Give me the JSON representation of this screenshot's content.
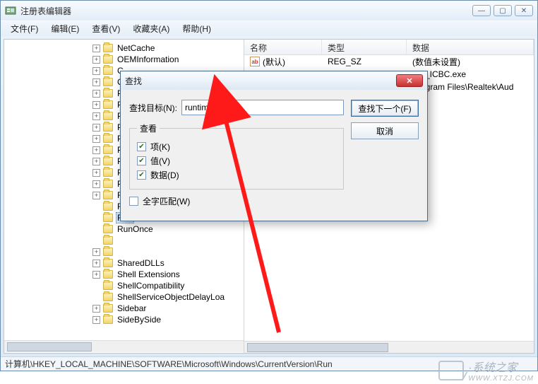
{
  "window": {
    "title": "注册表编辑器",
    "buttons": {
      "min": "—",
      "max": "▢",
      "close": "✕"
    }
  },
  "menu": {
    "file": "文件(F)",
    "edit": "编辑(E)",
    "view": "查看(V)",
    "favorites": "收藏夹(A)",
    "help": "帮助(H)"
  },
  "tree": {
    "items": [
      {
        "toggle": "+",
        "label": "NetCache"
      },
      {
        "toggle": "+",
        "label": "OEMInformation"
      },
      {
        "toggle": "+",
        "label": "C"
      },
      {
        "toggle": "+",
        "label": "C"
      },
      {
        "toggle": "+",
        "label": "P"
      },
      {
        "toggle": "+",
        "label": "P"
      },
      {
        "toggle": "+",
        "label": "P"
      },
      {
        "toggle": "+",
        "label": "P"
      },
      {
        "toggle": "+",
        "label": "P"
      },
      {
        "toggle": "+",
        "label": "P"
      },
      {
        "toggle": "+",
        "label": "P"
      },
      {
        "toggle": "+",
        "label": "P"
      },
      {
        "toggle": "+",
        "label": "P"
      },
      {
        "toggle": "+",
        "label": "Reliability"
      },
      {
        "toggle": " ",
        "label": "RenameFiles"
      },
      {
        "toggle": " ",
        "label": "Run",
        "selected": true
      },
      {
        "toggle": " ",
        "label": "RunOnce"
      },
      {
        "toggle": " ",
        "label": ""
      },
      {
        "toggle": "+",
        "label": ""
      },
      {
        "toggle": "+",
        "label": "SharedDLLs"
      },
      {
        "toggle": "+",
        "label": "Shell Extensions"
      },
      {
        "toggle": " ",
        "label": "ShellCompatibility"
      },
      {
        "toggle": " ",
        "label": "ShellServiceObjectDelayLoa"
      },
      {
        "toggle": "+",
        "label": "Sidebar"
      },
      {
        "toggle": "+",
        "label": "SideBySide"
      }
    ]
  },
  "list": {
    "cols": {
      "name": "名称",
      "type": "类型",
      "data": "数据"
    },
    "rows": [
      {
        "icon": "ab",
        "name": "(默认)",
        "type": "REG_SZ",
        "data": "(数值未设置)"
      },
      {
        "icon": "",
        "name": "",
        "type": "",
        "data": "Svr_ICBC.exe"
      },
      {
        "icon": "",
        "name": "",
        "type": "",
        "data": "Program Files\\Realtek\\Aud"
      }
    ]
  },
  "status": {
    "path": "计算机\\HKEY_LOCAL_MACHINE\\SOFTWARE\\Microsoft\\Windows\\CurrentVersion\\Run"
  },
  "dialog": {
    "title": "查找",
    "target_label": "查找目标(N):",
    "target_value": "runtime",
    "lookat_legend": "查看",
    "chk_keys": "项(K)",
    "chk_values": "值(V)",
    "chk_data": "数据(D)",
    "chk_whole": "全字匹配(W)",
    "find_next": "查找下一个(F)",
    "cancel": "取消",
    "checked": "✔"
  },
  "watermark": {
    "text": "·系统之家",
    "url": "WWW.XTZJ.COM"
  }
}
